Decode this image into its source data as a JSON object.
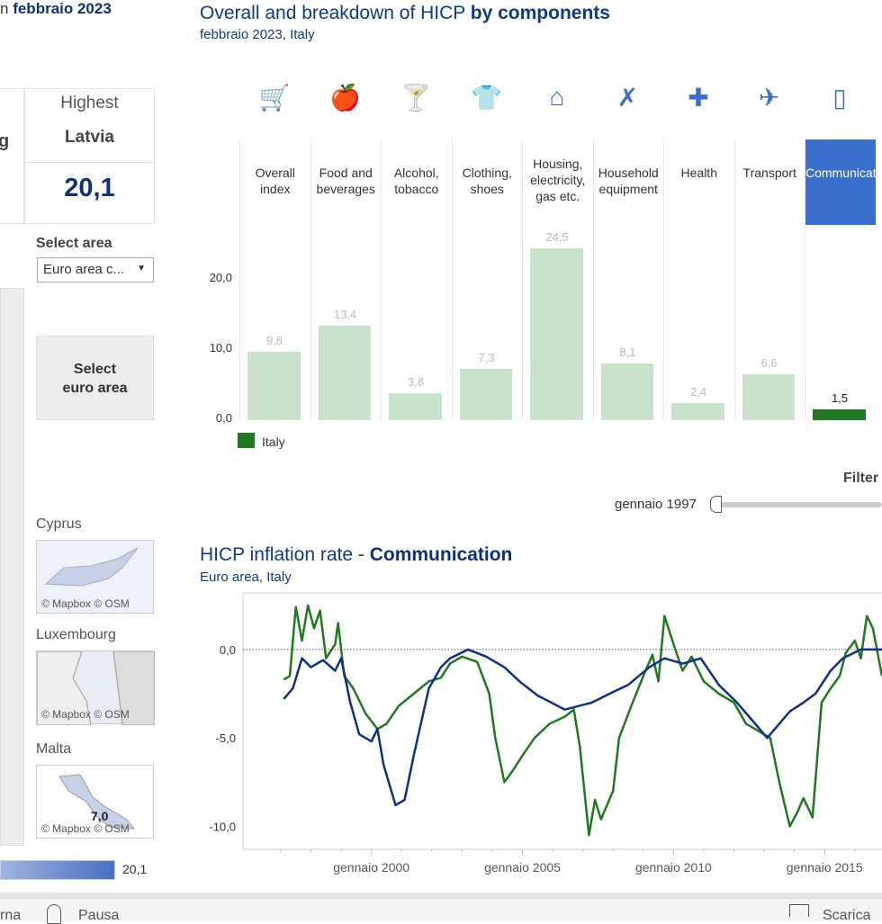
{
  "left": {
    "header_fragment": "n ",
    "header_date": "febbraio 2023",
    "kpi_cut_label": "g",
    "highest_label": "Highest",
    "highest_country": "Latvia",
    "highest_value": "20,1",
    "select_area_label": "Select area",
    "select_area_value": "Euro area c...",
    "select_button": "Select\neuro area",
    "insets": [
      {
        "name": "Cyprus",
        "credit": "© Mapbox  © OSM"
      },
      {
        "name": "Luxembourg",
        "credit": "© Mapbox  © OSM"
      },
      {
        "name": "Malta",
        "credit": "© Mapbox  © OSM",
        "value": "7,0"
      }
    ],
    "legend_max": "20,1"
  },
  "filter": {
    "label": "Filter",
    "slider_start": "gennaio 1997"
  },
  "toolbar": {
    "left_fragment": "rna",
    "pause": "Pausa",
    "download": "Scarica"
  },
  "colors": {
    "italy": "#1f7a1f",
    "euro": "#0e2f8a",
    "bar_light": "#c9e2cc",
    "accent": "#3a6fce"
  },
  "chart_data": [
    {
      "type": "bar",
      "title": "Overall and breakdown of HICP",
      "title_bold": "by components",
      "subtitle": "febbraio 2023, Italy",
      "categories": [
        "Overall index",
        "Food and beverages",
        "Alcohol, tobacco",
        "Clothing, shoes",
        "Housing, electricity, gas etc.",
        "Household equipment",
        "Health",
        "Transport",
        "Communication"
      ],
      "icons": [
        "cart-icon",
        "apple-icon",
        "cocktail-icon",
        "shirt-icon",
        "house-icon",
        "tools-icon",
        "cross-icon",
        "plane-icon",
        "phone-icon"
      ],
      "values": [
        9.8,
        13.4,
        3.8,
        7.3,
        24.5,
        8.1,
        2.4,
        6.6,
        1.5
      ],
      "value_labels": [
        "9,8",
        "13,4",
        "3,8",
        "7,3",
        "24,5",
        "8,1",
        "2,4",
        "6,6",
        "1,5"
      ],
      "selected": "Communication",
      "ylim": [
        0,
        28
      ],
      "yticks": [
        0,
        10,
        20
      ],
      "ytick_labels": [
        "0,0",
        "10,0",
        "20,0"
      ],
      "legend": [
        "Italy"
      ]
    },
    {
      "type": "line",
      "title": "HICP inflation rate - ",
      "title_bold": "Communication",
      "subtitle": "Euro area, Italy",
      "ylim": [
        -11.3,
        3.2
      ],
      "xlim": [
        1995.75,
        2016.9
      ],
      "yticks": [
        0,
        -5,
        -10
      ],
      "ytick_labels": [
        "0,0",
        "-5,0",
        "-10,0"
      ],
      "xticks": [
        2000,
        2005,
        2010,
        2015
      ],
      "xtick_labels": [
        "gennaio 2000",
        "gennaio 2005",
        "gennaio 2010",
        "gennaio 2015"
      ],
      "series": [
        {
          "name": "Italy",
          "color": "#1f7a1f",
          "points": [
            [
              1997.1,
              -1.7
            ],
            [
              1997.3,
              -1.5
            ],
            [
              1997.5,
              2.4
            ],
            [
              1997.7,
              0.5
            ],
            [
              1997.9,
              2.5
            ],
            [
              1998.1,
              1.2
            ],
            [
              1998.3,
              2.2
            ],
            [
              1998.5,
              -0.5
            ],
            [
              1998.8,
              0.3
            ],
            [
              1998.9,
              1.5
            ],
            [
              1999.1,
              -1.5
            ],
            [
              1999.4,
              -2.2
            ],
            [
              1999.8,
              -3.6
            ],
            [
              2000.2,
              -4.5
            ],
            [
              2000.5,
              -4.2
            ],
            [
              2000.9,
              -3.2
            ],
            [
              2001.4,
              -2.5
            ],
            [
              2001.9,
              -1.8
            ],
            [
              2002.3,
              -1.6
            ],
            [
              2002.6,
              -0.8
            ],
            [
              2003.0,
              -0.4
            ],
            [
              2003.5,
              -0.7
            ],
            [
              2003.9,
              -2.5
            ],
            [
              2004.1,
              -5
            ],
            [
              2004.4,
              -7.5
            ],
            [
              2004.7,
              -6.8
            ],
            [
              2005.0,
              -6
            ],
            [
              2005.4,
              -5
            ],
            [
              2005.9,
              -4.2
            ],
            [
              2006.4,
              -3.8
            ],
            [
              2006.7,
              -3.4
            ],
            [
              2006.9,
              -5.5
            ],
            [
              2007.2,
              -10.5
            ],
            [
              2007.4,
              -8.5
            ],
            [
              2007.6,
              -9.6
            ],
            [
              2008.0,
              -8
            ],
            [
              2008.2,
              -5
            ],
            [
              2008.6,
              -3.2
            ],
            [
              2009.0,
              -1.5
            ],
            [
              2009.3,
              -0.3
            ],
            [
              2009.5,
              -1.8
            ],
            [
              2009.7,
              1.9
            ],
            [
              2010.0,
              0.3
            ],
            [
              2010.3,
              -1.2
            ],
            [
              2010.6,
              -0.4
            ],
            [
              2011.0,
              -1.8
            ],
            [
              2011.5,
              -2.5
            ],
            [
              2012.0,
              -3
            ],
            [
              2012.4,
              -4.2
            ],
            [
              2012.8,
              -4.6
            ],
            [
              2013.2,
              -5
            ],
            [
              2013.5,
              -7.5
            ],
            [
              2013.85,
              -10
            ],
            [
              2014.1,
              -9.2
            ],
            [
              2014.3,
              -8.4
            ],
            [
              2014.6,
              -9.5
            ],
            [
              2014.9,
              -3
            ],
            [
              2015.2,
              -2.2
            ],
            [
              2015.5,
              -1.5
            ],
            [
              2015.7,
              -0.2
            ],
            [
              2016.0,
              0.5
            ],
            [
              2016.2,
              -0.5
            ],
            [
              2016.4,
              1.9
            ],
            [
              2016.6,
              1.2
            ],
            [
              2016.9,
              -1.5
            ]
          ]
        },
        {
          "name": "Euro area",
          "color": "#0e2f8a",
          "points": [
            [
              1997.1,
              -2.8
            ],
            [
              1997.4,
              -2.2
            ],
            [
              1997.7,
              -0.5
            ],
            [
              1998.0,
              -1
            ],
            [
              1998.4,
              -0.6
            ],
            [
              1998.8,
              -1.2
            ],
            [
              1999.0,
              -0.5
            ],
            [
              1999.3,
              -3
            ],
            [
              1999.6,
              -4.8
            ],
            [
              2000.0,
              -5.2
            ],
            [
              2000.2,
              -4.5
            ],
            [
              2000.4,
              -6.5
            ],
            [
              2000.8,
              -8.8
            ],
            [
              2001.1,
              -8.5
            ],
            [
              2001.4,
              -6
            ],
            [
              2001.9,
              -2.2
            ],
            [
              2002.3,
              -1
            ],
            [
              2002.6,
              -0.5
            ],
            [
              2003.2,
              0
            ],
            [
              2003.8,
              -0.4
            ],
            [
              2004.4,
              -1
            ],
            [
              2004.9,
              -1.8
            ],
            [
              2005.5,
              -2.6
            ],
            [
              2006.4,
              -3.4
            ],
            [
              2007.3,
              -3
            ],
            [
              2008.0,
              -2.4
            ],
            [
              2008.5,
              -2
            ],
            [
              2009.2,
              -1
            ],
            [
              2009.7,
              -0.5
            ],
            [
              2010.3,
              -0.8
            ],
            [
              2010.9,
              -0.5
            ],
            [
              2011.5,
              -2
            ],
            [
              2012.1,
              -3
            ],
            [
              2012.6,
              -4
            ],
            [
              2013.1,
              -5
            ],
            [
              2013.5,
              -4.2
            ],
            [
              2013.85,
              -3.5
            ],
            [
              2014.3,
              -3
            ],
            [
              2014.7,
              -2.5
            ],
            [
              2015.2,
              -1.2
            ],
            [
              2015.6,
              -0.5
            ],
            [
              2016.2,
              0
            ],
            [
              2016.9,
              0
            ]
          ]
        }
      ]
    }
  ]
}
